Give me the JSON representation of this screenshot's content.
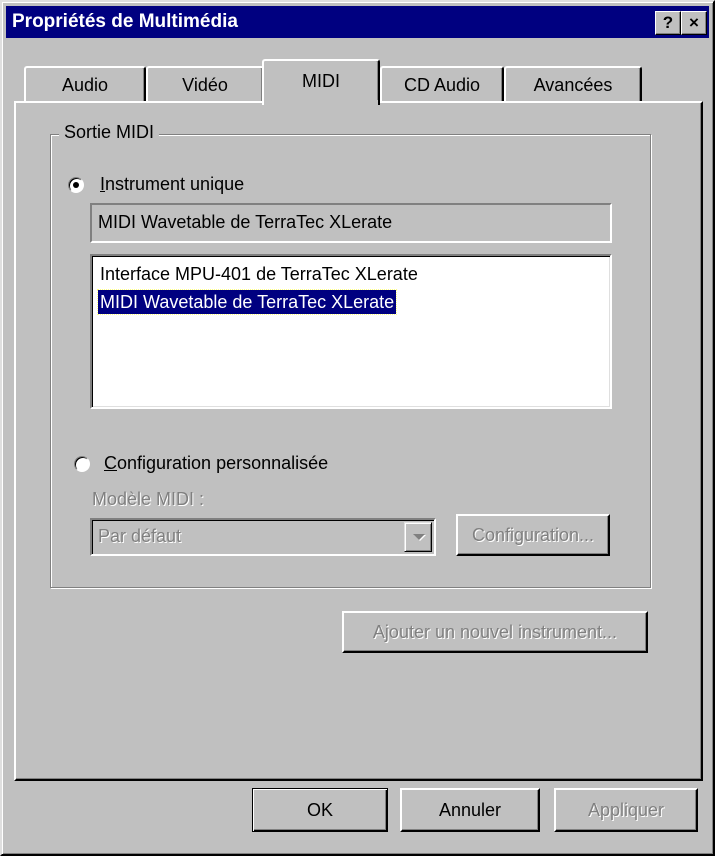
{
  "window": {
    "title": "Propriétés de Multimédia",
    "help_button": "?",
    "close_button": "×"
  },
  "tabs": [
    {
      "label": "Audio",
      "active": false
    },
    {
      "label": "Vidéo",
      "active": false
    },
    {
      "label": "MIDI",
      "active": true
    },
    {
      "label": "CD Audio",
      "active": false
    },
    {
      "label": "Avancées",
      "active": false
    }
  ],
  "midi_output": {
    "group_title": "Sortie MIDI",
    "single_instrument": {
      "mnemonic": "I",
      "label_rest": "nstrument unique",
      "selected": true
    },
    "current_instrument": "MIDI Wavetable de TerraTec XLerate",
    "instruments": [
      {
        "label": "Interface MPU-401 de TerraTec XLerate",
        "selected": false
      },
      {
        "label": "MIDI Wavetable de TerraTec XLerate",
        "selected": true
      }
    ],
    "custom_config": {
      "mnemonic": "C",
      "label_rest": "onfiguration personnalisée",
      "selected": false
    },
    "midi_scheme_label": "Modèle MIDI :",
    "midi_scheme_value": "Par défaut",
    "configure_button": "Configuration..."
  },
  "add_instrument_button": "Ajouter un nouvel instrument...",
  "footer": {
    "ok": "OK",
    "cancel": "Annuler",
    "apply": "Appliquer"
  },
  "colors": {
    "face": "#c0c0c0",
    "titlebar": "#000080",
    "selection": "#000080",
    "disabled_text": "#808080"
  }
}
